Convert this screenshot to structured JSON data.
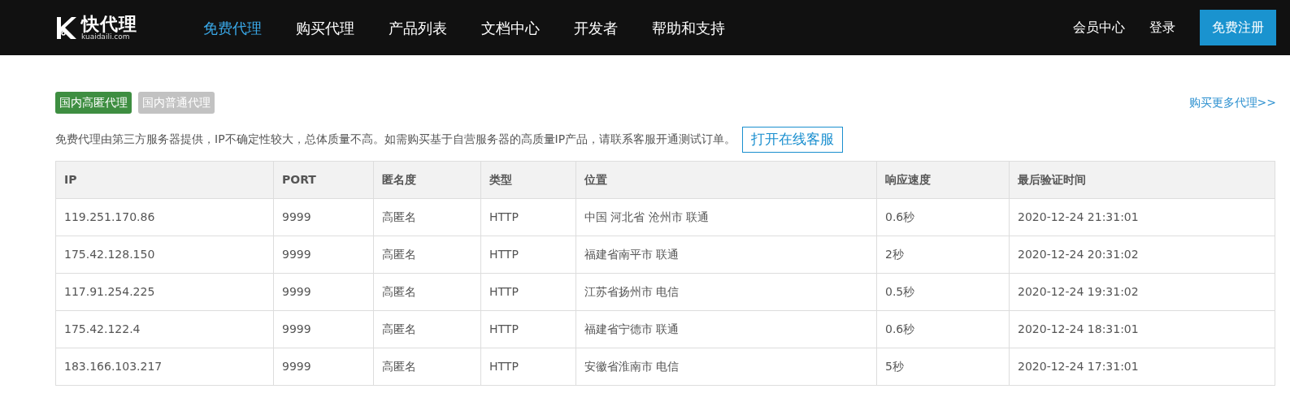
{
  "header": {
    "logo": {
      "name": "快代理",
      "domain": "kuaidaili.com"
    },
    "nav": [
      {
        "label": "免费代理",
        "selected": true
      },
      {
        "label": "购买代理",
        "selected": false
      },
      {
        "label": "产品列表",
        "selected": false
      },
      {
        "label": "文档中心",
        "selected": false
      },
      {
        "label": "开发者",
        "selected": false
      },
      {
        "label": "帮助和支持",
        "selected": false
      }
    ],
    "links": [
      "会员中心",
      "登录"
    ],
    "register_button": "免费注册"
  },
  "tabs": [
    {
      "label": "国内高匿代理",
      "selected": true
    },
    {
      "label": "国内普通代理",
      "selected": false
    }
  ],
  "more_link": "购买更多代理>>",
  "notice": "免费代理由第三方服务器提供，IP不确定性较大，总体质量不高。如需购买基于自营服务器的高质量IP产品，请联系客服开通测试订单。",
  "service_button": "打开在线客服",
  "table": {
    "columns": [
      "IP",
      "PORT",
      "匿名度",
      "类型",
      "位置",
      "响应速度",
      "最后验证时间"
    ],
    "rows": [
      [
        "119.251.170.86",
        "9999",
        "高匿名",
        "HTTP",
        "中国 河北省 沧州市 联通",
        "0.6秒",
        "2020-12-24 21:31:01"
      ],
      [
        "175.42.128.150",
        "9999",
        "高匿名",
        "HTTP",
        "福建省南平市 联通",
        "2秒",
        "2020-12-24 20:31:02"
      ],
      [
        "117.91.254.225",
        "9999",
        "高匿名",
        "HTTP",
        "江苏省扬州市 电信",
        "0.5秒",
        "2020-12-24 19:31:02"
      ],
      [
        "175.42.122.4",
        "9999",
        "高匿名",
        "HTTP",
        "福建省宁德市 联通",
        "0.6秒",
        "2020-12-24 18:31:01"
      ],
      [
        "183.166.103.217",
        "9999",
        "高匿名",
        "HTTP",
        "安徽省淮南市 电信",
        "5秒",
        "2020-12-24 17:31:01"
      ]
    ]
  }
}
